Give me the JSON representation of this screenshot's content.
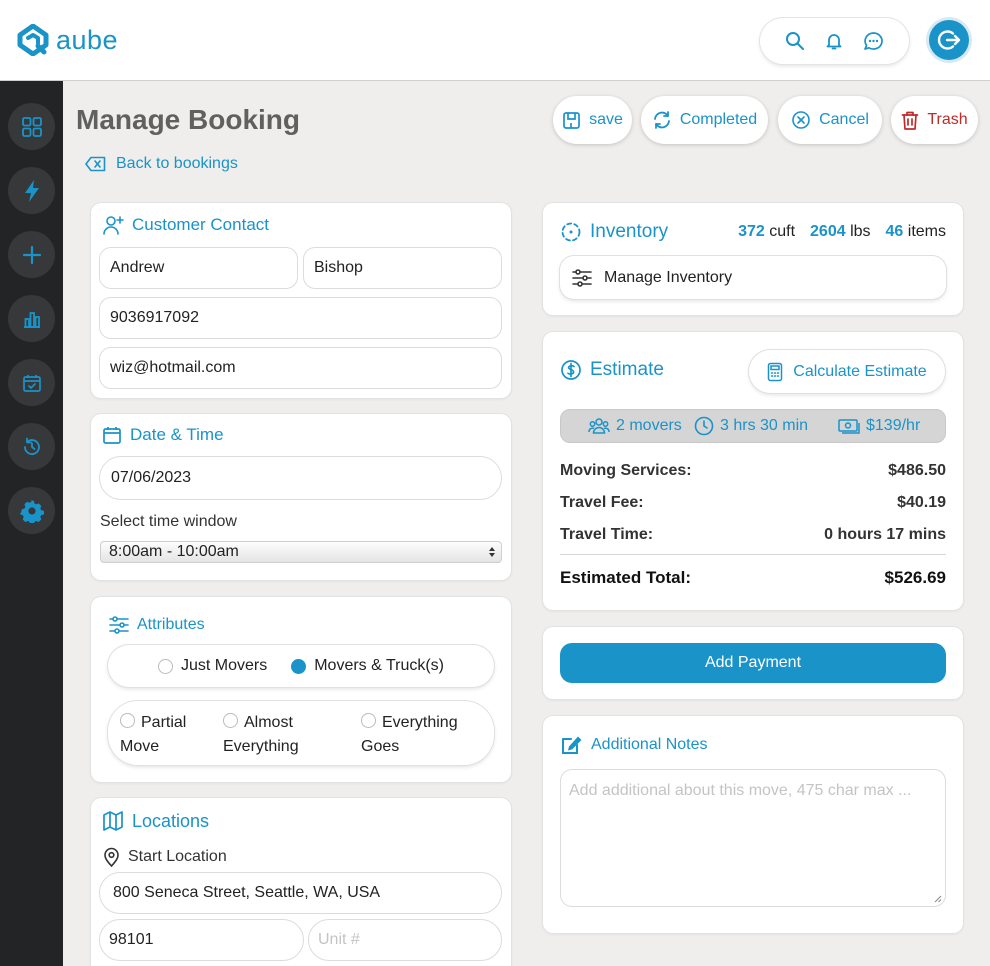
{
  "app": {
    "logo_text": "aube",
    "accent": "#1a93c9",
    "danger": "#c02a2a"
  },
  "header": {
    "icons": [
      "search-icon",
      "bell-icon",
      "chat-icon"
    ],
    "logout_icon": "logout-icon"
  },
  "sidebar": {
    "icons": [
      "dashboard-icon",
      "bolt-icon",
      "plus-icon",
      "chart-icon",
      "calendar-check-icon",
      "history-icon",
      "gear-icon"
    ]
  },
  "page": {
    "title": "Manage Booking",
    "back_label": "Back to bookings"
  },
  "actions": {
    "save": "save",
    "completed": "Completed",
    "cancel": "Cancel",
    "trash": "Trash"
  },
  "contact": {
    "title": "Customer Contact",
    "first_name": "Andrew",
    "last_name": "Bishop",
    "phone": "9036917092",
    "email": "wiz@hotmail.com"
  },
  "datetime": {
    "title": "Date & Time",
    "date": "07/06/2023",
    "window_label": "Select time window",
    "window_value": "8:00am - 10:00am"
  },
  "attributes": {
    "title": "Attributes",
    "service_options": [
      "Just Movers",
      "Movers & Truck(s)"
    ],
    "service_selected": "Movers & Truck(s)",
    "move_opt1_line1": "Partial",
    "move_opt1_line2": "Move",
    "move_opt2_line1": "Almost",
    "move_opt2_line2": "Everything",
    "move_opt3_line1": "Everything",
    "move_opt3_line2": "Goes"
  },
  "locations": {
    "title": "Locations",
    "start_label": "Start Location",
    "address": "800 Seneca Street, Seattle, WA, USA",
    "zip": "98101",
    "unit_placeholder": "Unit #"
  },
  "inventory": {
    "title": "Inventory",
    "cuft": "372",
    "cuft_unit": "cuft",
    "lbs": "2604",
    "lbs_unit": "lbs",
    "items": "46",
    "items_unit": "items",
    "manage_label": "Manage Inventory"
  },
  "estimate": {
    "title": "Estimate",
    "calc_label": "Calculate Estimate",
    "movers": "2 movers",
    "duration": "3 hrs 30 min",
    "rate": "$139/hr",
    "rows": [
      {
        "label": "Moving Services:",
        "value": "$486.50"
      },
      {
        "label": "Travel Fee:",
        "value": "$40.19"
      },
      {
        "label": "Travel Time:",
        "value": "0 hours 17 mins"
      }
    ],
    "total_label": "Estimated Total:",
    "total_value": "$526.69"
  },
  "payment": {
    "label": "Add Payment"
  },
  "notes": {
    "title": "Additional Notes",
    "placeholder": "Add additional about this move, 475 char max ..."
  }
}
